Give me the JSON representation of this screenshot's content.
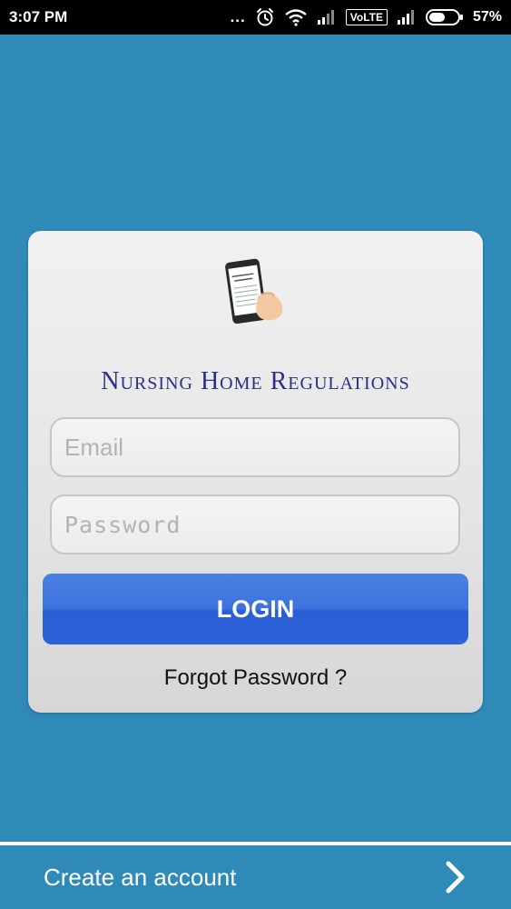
{
  "status_bar": {
    "time": "3:07 PM",
    "overflow_dots": "...",
    "volte": "VoLTE",
    "battery_percent": "57%",
    "battery_level": 0.57
  },
  "login_card": {
    "app_title": "Nursing Home Regulations",
    "logo_icon": "phone-in-hand-icon",
    "email_placeholder": "Email",
    "email_value": "",
    "password_placeholder": "Password",
    "password_value": "",
    "login_button_label": "LOGIN",
    "forgot_password_label": "Forgot Password ?"
  },
  "footer": {
    "create_account_label": "Create an account",
    "chevron_icon": "chevron-right-icon"
  },
  "colors": {
    "background": "#2f8ab8",
    "status_bar": "#000000",
    "button": "#3c73dd",
    "title": "#2b2f86"
  }
}
